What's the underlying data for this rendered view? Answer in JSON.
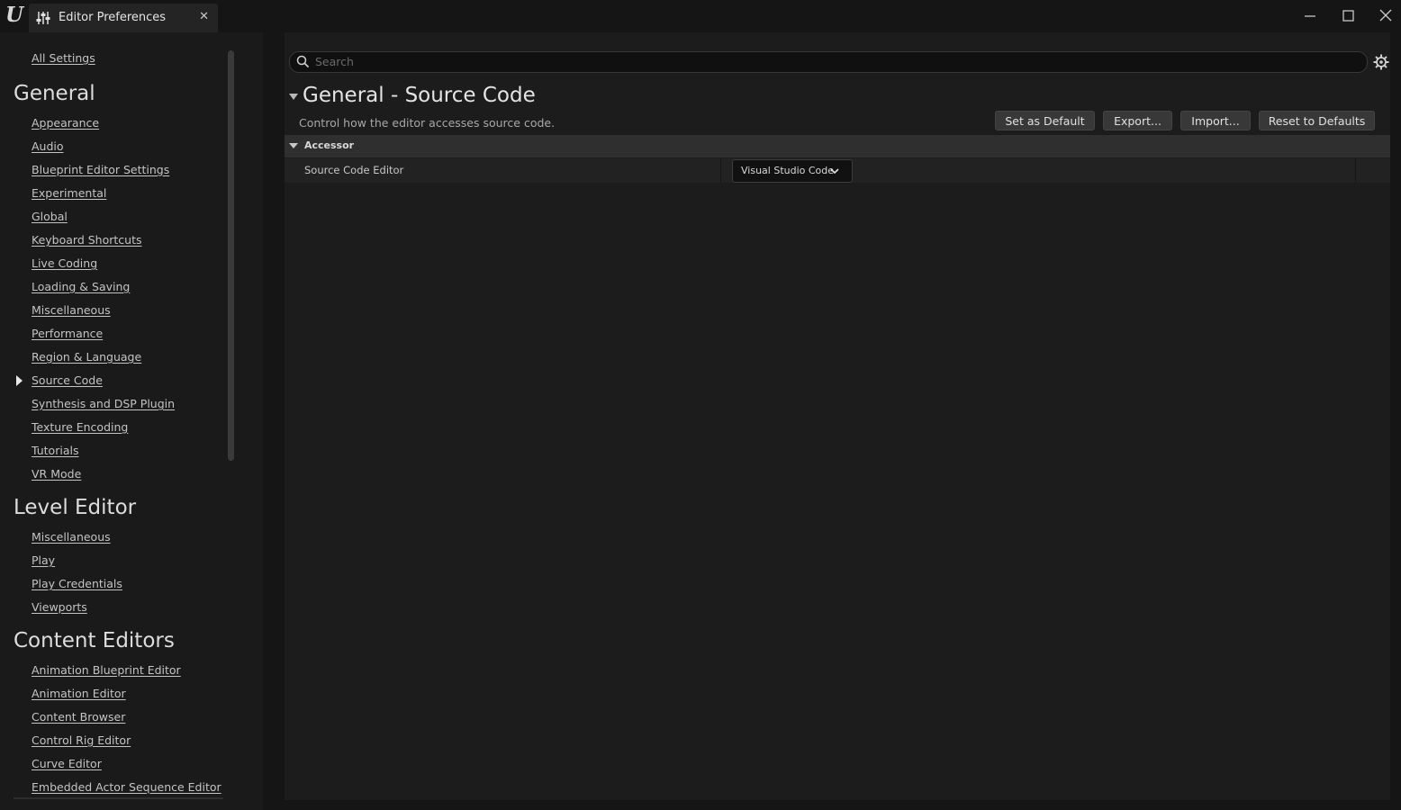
{
  "window": {
    "tab_title": "Editor Preferences"
  },
  "sidebar": {
    "all_settings": "All Settings",
    "sections": [
      {
        "title": "General",
        "items": [
          "Appearance",
          "Audio",
          "Blueprint Editor Settings",
          "Experimental",
          "Global",
          "Keyboard Shortcuts",
          "Live Coding",
          "Loading & Saving",
          "Miscellaneous",
          "Performance",
          "Region & Language",
          "Source Code",
          "Synthesis and DSP Plugin",
          "Texture Encoding",
          "Tutorials",
          "VR Mode"
        ]
      },
      {
        "title": "Level Editor",
        "items": [
          "Miscellaneous",
          "Play",
          "Play Credentials",
          "Viewports"
        ]
      },
      {
        "title": "Content Editors",
        "items": [
          "Animation Blueprint Editor",
          "Animation Editor",
          "Content Browser",
          "Control Rig Editor",
          "Curve Editor",
          "Embedded Actor Sequence Editor"
        ]
      }
    ],
    "selected_item": "Source Code"
  },
  "search": {
    "placeholder": "Search",
    "value": ""
  },
  "section": {
    "title": "General - Source Code",
    "description": "Control how the editor accesses source code.",
    "buttons": {
      "set_default": "Set as Default",
      "export": "Export...",
      "import": "Import...",
      "reset": "Reset to Defaults"
    },
    "category": "Accessor",
    "property": {
      "name": "Source Code Editor",
      "value": "Visual Studio Code"
    }
  },
  "icons": {
    "logo": "unreal-logo-icon",
    "tab": "sliders-icon",
    "close": "close-icon",
    "minimize": "minimize-icon",
    "maximize": "maximize-icon",
    "window_close": "window-close-icon",
    "search": "search-icon",
    "settings": "gear-icon"
  }
}
